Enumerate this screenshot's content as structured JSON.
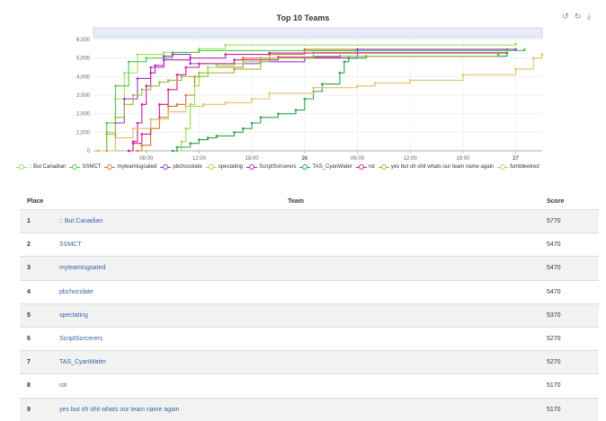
{
  "chart_data": {
    "type": "line",
    "title": "Top 10 Teams",
    "y_ticks": [
      "0",
      "1,000",
      "2,000",
      "3,000",
      "4,000",
      "5,000",
      "6,000"
    ],
    "ylim": [
      0,
      6000
    ],
    "x_ticks": [
      "06:00",
      "12:00",
      "18:00",
      "26",
      "06:00",
      "12:00",
      "18:00",
      "27"
    ],
    "x_tick_hours": [
      6,
      12,
      18,
      24,
      30,
      36,
      42,
      48
    ],
    "xlim_hours": [
      0,
      51
    ],
    "grid": true,
    "legend_position": "bottom",
    "series": [
      {
        "name": ":: But Canadian",
        "color": "#9fe060",
        "points": [
          [
            0.5,
            0
          ],
          [
            1.5,
            1000
          ],
          [
            2.5,
            2800
          ],
          [
            3.5,
            4200
          ],
          [
            5,
            5200
          ],
          [
            8,
            5300
          ],
          [
            12,
            5500
          ],
          [
            15,
            5700
          ],
          [
            48,
            5770
          ]
        ]
      },
      {
        "name": "SSMCT",
        "color": "#4cc84c",
        "points": [
          [
            0.5,
            0
          ],
          [
            1.5,
            1500
          ],
          [
            2.5,
            3500
          ],
          [
            4,
            4800
          ],
          [
            6,
            5000
          ],
          [
            9,
            5300
          ],
          [
            12,
            5400
          ],
          [
            49,
            5470
          ]
        ]
      },
      {
        "name": "myteamisgoated",
        "color": "#d07a2e",
        "points": [
          [
            5,
            0
          ],
          [
            5.5,
            300
          ],
          [
            6.5,
            1200
          ],
          [
            7.5,
            1800
          ],
          [
            8.5,
            2400
          ],
          [
            9.5,
            2500
          ],
          [
            10.5,
            3000
          ],
          [
            11.5,
            4000
          ],
          [
            13,
            4500
          ],
          [
            17,
            5000
          ],
          [
            20,
            5200
          ],
          [
            24,
            5470
          ],
          [
            47,
            5470
          ]
        ]
      },
      {
        "name": "pbchocolate",
        "color": "#8a3ccc",
        "points": [
          [
            1.5,
            0
          ],
          [
            2.5,
            1500
          ],
          [
            3.5,
            2800
          ],
          [
            5,
            3900
          ],
          [
            6.5,
            4500
          ],
          [
            8,
            5100
          ],
          [
            9,
            5200
          ],
          [
            11,
            4700
          ],
          [
            19,
            4800
          ],
          [
            24,
            5000
          ],
          [
            30,
            5470
          ],
          [
            48,
            5470
          ]
        ]
      },
      {
        "name": "spectating",
        "color": "#9ade50",
        "points": [
          [
            9.5,
            0
          ],
          [
            10,
            500
          ],
          [
            10.5,
            1200
          ],
          [
            11,
            2500
          ],
          [
            11.5,
            3500
          ],
          [
            12,
            4000
          ],
          [
            13,
            4500
          ],
          [
            14,
            4600
          ],
          [
            16,
            4700
          ],
          [
            17,
            4800
          ],
          [
            20,
            5000
          ],
          [
            25,
            5300
          ],
          [
            47,
            5370
          ]
        ]
      },
      {
        "name": "ScriptSorcerers",
        "color": "#c81ea8",
        "points": [
          [
            4,
            0
          ],
          [
            4.5,
            500
          ],
          [
            5,
            1500
          ],
          [
            5.5,
            2500
          ],
          [
            6,
            3500
          ],
          [
            6.5,
            4200
          ],
          [
            7,
            4600
          ],
          [
            8,
            4900
          ],
          [
            11,
            5000
          ],
          [
            15,
            5200
          ],
          [
            20,
            5270
          ],
          [
            47,
            5270
          ]
        ]
      },
      {
        "name": "TAS_CyanWater",
        "color": "#2ca050",
        "points": [
          [
            9,
            0
          ],
          [
            9.5,
            200
          ],
          [
            11,
            400
          ],
          [
            12,
            600
          ],
          [
            13,
            700
          ],
          [
            14,
            800
          ],
          [
            16,
            1000
          ],
          [
            17,
            1200
          ],
          [
            18,
            1500
          ],
          [
            19,
            1800
          ],
          [
            21,
            2000
          ],
          [
            23,
            2200
          ],
          [
            24,
            2800
          ],
          [
            25,
            3200
          ],
          [
            26,
            3600
          ],
          [
            28,
            4200
          ],
          [
            28.5,
            4800
          ],
          [
            29,
            5000
          ],
          [
            31,
            5100
          ],
          [
            47,
            5270
          ]
        ]
      },
      {
        "name": "rot",
        "color": "#d0208c",
        "points": [
          [
            4,
            0
          ],
          [
            4.5,
            400
          ],
          [
            5.5,
            900
          ],
          [
            6.5,
            1700
          ],
          [
            7.5,
            2500
          ],
          [
            8.5,
            3300
          ],
          [
            9.5,
            4100
          ],
          [
            10.5,
            4500
          ],
          [
            12,
            4700
          ],
          [
            16,
            4900
          ],
          [
            21,
            5050
          ],
          [
            28,
            5100
          ],
          [
            46,
            5170
          ]
        ]
      },
      {
        "name": "yes but oh shit whats our team name again",
        "color": "#a2b83c",
        "points": [
          [
            0.5,
            0
          ],
          [
            1.5,
            900
          ],
          [
            2.5,
            1800
          ],
          [
            3.5,
            2500
          ],
          [
            4.5,
            3000
          ],
          [
            5.5,
            3300
          ],
          [
            6.5,
            3500
          ],
          [
            7.5,
            3700
          ],
          [
            8.5,
            3800
          ],
          [
            10,
            4000
          ],
          [
            12,
            4200
          ],
          [
            16,
            4400
          ],
          [
            19,
            5000
          ],
          [
            25,
            5100
          ],
          [
            46,
            5170
          ]
        ]
      },
      {
        "name": "fumblewired",
        "color": "#e3c265",
        "points": [
          [
            0.5,
            0
          ],
          [
            2.5,
            700
          ],
          [
            4.5,
            1200
          ],
          [
            6.5,
            1700
          ],
          [
            8.5,
            2100
          ],
          [
            10.5,
            2400
          ],
          [
            12.5,
            2500
          ],
          [
            15,
            2600
          ],
          [
            18,
            2800
          ],
          [
            20,
            3100
          ],
          [
            25,
            3400
          ],
          [
            30,
            3500
          ],
          [
            32,
            3650
          ],
          [
            36,
            3800
          ],
          [
            42,
            4100
          ],
          [
            48,
            4400
          ],
          [
            50,
            5000
          ],
          [
            51,
            5200
          ]
        ]
      }
    ]
  },
  "toolbar": {
    "icons": [
      "zoom-reset-icon",
      "restore-icon",
      "download-icon"
    ]
  },
  "table": {
    "headers": {
      "place": "Place",
      "team": "Team",
      "score": "Score"
    },
    "rows": [
      {
        "place": "1",
        "team": ":: But Canadian",
        "score": "5770"
      },
      {
        "place": "2",
        "team": "SSMCT",
        "score": "5470"
      },
      {
        "place": "3",
        "team": "myteamisgoated",
        "score": "5470"
      },
      {
        "place": "4",
        "team": "pbchocolate",
        "score": "5470"
      },
      {
        "place": "5",
        "team": "spectating",
        "score": "5370"
      },
      {
        "place": "6",
        "team": "ScriptSorcerers",
        "score": "5270"
      },
      {
        "place": "7",
        "team": "TAS_CyanWater",
        "score": "5270"
      },
      {
        "place": "8",
        "team": "rot",
        "score": "5170"
      },
      {
        "place": "9",
        "team": "yes but oh shit whats our team name again",
        "score": "5170"
      }
    ]
  }
}
